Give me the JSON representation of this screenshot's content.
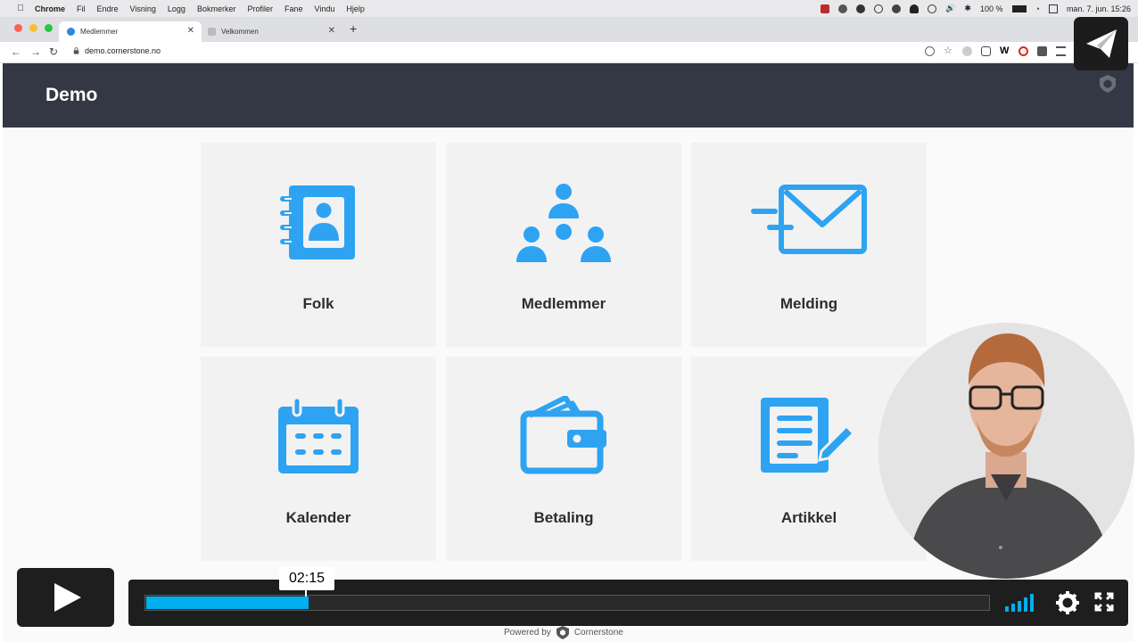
{
  "menubar": {
    "app": "Chrome",
    "items": [
      "Fil",
      "Endre",
      "Visning",
      "Logg",
      "Bokmerker",
      "Profiler",
      "Fane",
      "Vindu",
      "Hjelp"
    ],
    "battery": "100 %",
    "datetime": "man. 7. jun. 15:26"
  },
  "browser": {
    "tabs": [
      {
        "title": "Medlemmer"
      },
      {
        "title": "Velkommen"
      }
    ],
    "url": "demo.cornerstone.no"
  },
  "header": {
    "title": "Demo"
  },
  "tiles": [
    {
      "label": "Folk"
    },
    {
      "label": "Medlemmer"
    },
    {
      "label": "Melding"
    },
    {
      "label": "Kalender"
    },
    {
      "label": "Betaling"
    },
    {
      "label": "Artikkel"
    }
  ],
  "player": {
    "timecode": "02:15",
    "progress_fraction": 0.192
  },
  "footer": {
    "powered_by": "Powered by",
    "brand": "Cornerstone"
  },
  "colors": {
    "accent": "#2ea3f2",
    "header_bg": "#343844",
    "player_progress": "#00adef",
    "tile_bg": "#f2f2f2"
  }
}
